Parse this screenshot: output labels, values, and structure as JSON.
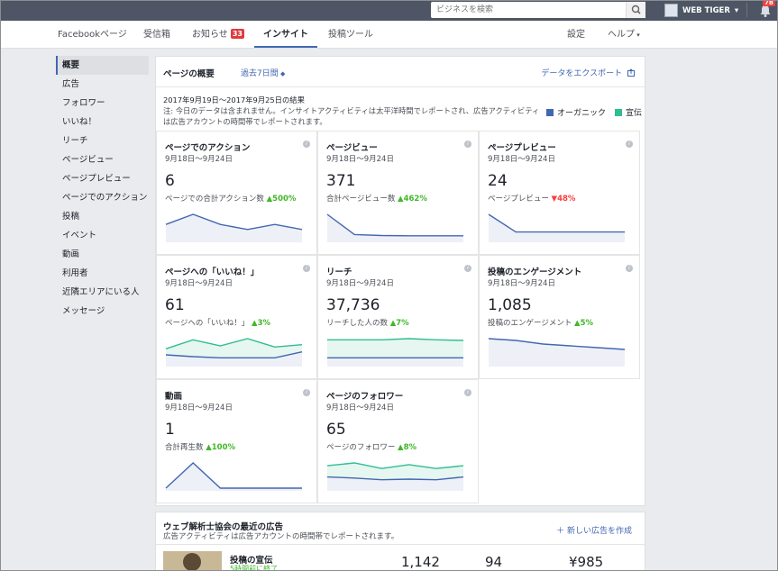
{
  "topbar": {
    "search_placeholder": "ビジネスを検索",
    "page_name": "WEB TIGER",
    "notification_count": "78"
  },
  "nav": {
    "items": [
      {
        "label": "Facebookページ"
      },
      {
        "label": "受信箱"
      },
      {
        "label": "お知らせ",
        "badge": "33"
      },
      {
        "label": "インサイト"
      },
      {
        "label": "投稿ツール"
      }
    ],
    "settings": "設定",
    "help": "ヘルプ"
  },
  "sidebar": {
    "items": [
      {
        "label": "概要"
      },
      {
        "label": "広告"
      },
      {
        "label": "フォロワー"
      },
      {
        "label": "いいね！"
      },
      {
        "label": "リーチ"
      },
      {
        "label": "ページビュー"
      },
      {
        "label": "ページプレビュー"
      },
      {
        "label": "ページでのアクション"
      },
      {
        "label": "投稿"
      },
      {
        "label": "イベント"
      },
      {
        "label": "動画"
      },
      {
        "label": "利用者"
      },
      {
        "label": "近隣エリアにいる人"
      },
      {
        "label": "メッセージ"
      }
    ]
  },
  "overview": {
    "title": "ページの概要",
    "range": "過去7日間",
    "export": "データをエクスポート",
    "date_range": "2017年9月19日〜2017年9月25日の結果",
    "note": "注: 今日のデータは含まれません。インサイトアクティビティは太平洋時間でレポートされ、広告アクティビティは広告アカウントの時間帯でレポートされます。",
    "legend_organic": "オーガニック",
    "legend_paid": "宣伝",
    "color_organic": "#4267b2",
    "color_paid": "#2fbd93"
  },
  "cards": [
    {
      "title": "ページでのアクション",
      "dates": "9月18日〜9月24日",
      "value": "6",
      "sub": "ページでの合計アクション数",
      "change": "▲500%",
      "dir": "up",
      "chart_data": {
        "type": "area",
        "series": [
          {
            "values": [
              3,
              5,
              3,
              2,
              3,
              2
            ]
          }
        ]
      }
    },
    {
      "title": "ページビュー",
      "dates": "9月18日〜9月24日",
      "value": "371",
      "sub": "合計ページビュー数",
      "change": "▲462%",
      "dir": "up",
      "chart_data": {
        "type": "area",
        "series": [
          {
            "values": [
              10,
              2,
              1.6,
              1.5,
              1.5,
              1.5
            ]
          }
        ]
      }
    },
    {
      "title": "ページプレビュー",
      "dates": "9月18日〜9月24日",
      "value": "24",
      "sub": "ページプレビュー",
      "change": "▼48%",
      "dir": "down",
      "chart_data": {
        "type": "area",
        "series": [
          {
            "values": [
              10,
              3,
              3,
              3,
              3,
              3
            ]
          }
        ]
      }
    },
    {
      "title": "ページへの「いいね！」",
      "dates": "9月18日〜9月24日",
      "value": "61",
      "sub": "ページへの「いいね！」",
      "change": "▲3%",
      "dir": "up",
      "chart_data": {
        "type": "area",
        "series": [
          {
            "values": [
              2.5,
              4,
              3,
              4.2,
              2.8,
              3.2
            ]
          },
          {
            "values": [
              1.5,
              1.2,
              1,
              1,
              1,
              2
            ]
          }
        ]
      }
    },
    {
      "title": "リーチ",
      "dates": "9月18日〜9月24日",
      "value": "37,736",
      "sub": "リーチした人の数",
      "change": "▲7%",
      "dir": "up",
      "chart_data": {
        "type": "area",
        "series": [
          {
            "values": [
              4,
              4,
              4,
              4.2,
              4,
              3.9
            ]
          },
          {
            "values": [
              1,
              1,
              1,
              1,
              1,
              1
            ]
          }
        ]
      }
    },
    {
      "title": "投稿のエンゲージメント",
      "dates": "9月18日〜9月24日",
      "value": "1,085",
      "sub": "投稿のエンゲージメント",
      "change": "▲5%",
      "dir": "up",
      "chart_data": {
        "type": "area",
        "series": [
          {
            "values": [
              7,
              6.5,
              5.5,
              5,
              4.5,
              4
            ]
          }
        ]
      }
    },
    {
      "title": "動画",
      "dates": "9月18日〜9月24日",
      "value": "1",
      "sub": "合計再生数",
      "change": "▲100%",
      "dir": "up",
      "chart_data": {
        "type": "area",
        "series": [
          {
            "values": [
              0,
              1,
              0,
              0,
              0,
              0
            ]
          }
        ]
      }
    },
    {
      "title": "ページのフォロワー",
      "dates": "9月18日〜9月24日",
      "value": "65",
      "sub": "ページのフォロワー",
      "change": "▲8%",
      "dir": "up",
      "chart_data": {
        "type": "area",
        "series": [
          {
            "values": [
              4,
              4.5,
              3.5,
              4.2,
              3.5,
              4
            ]
          },
          {
            "values": [
              2,
              1.8,
              1.5,
              1.6,
              1.5,
              2
            ]
          }
        ]
      }
    }
  ],
  "ads": {
    "title": "ウェブ解析士協会の最近の広告",
    "sub": "広告アクティビティは広告アカウントの時間帯でレポートされます。",
    "new_ad": "新しい広告を作成",
    "row": {
      "label": "投稿の宣伝",
      "status": "5時間前に終了",
      "v1": "1,142",
      "v2": "94",
      "v3": "¥985"
    }
  }
}
